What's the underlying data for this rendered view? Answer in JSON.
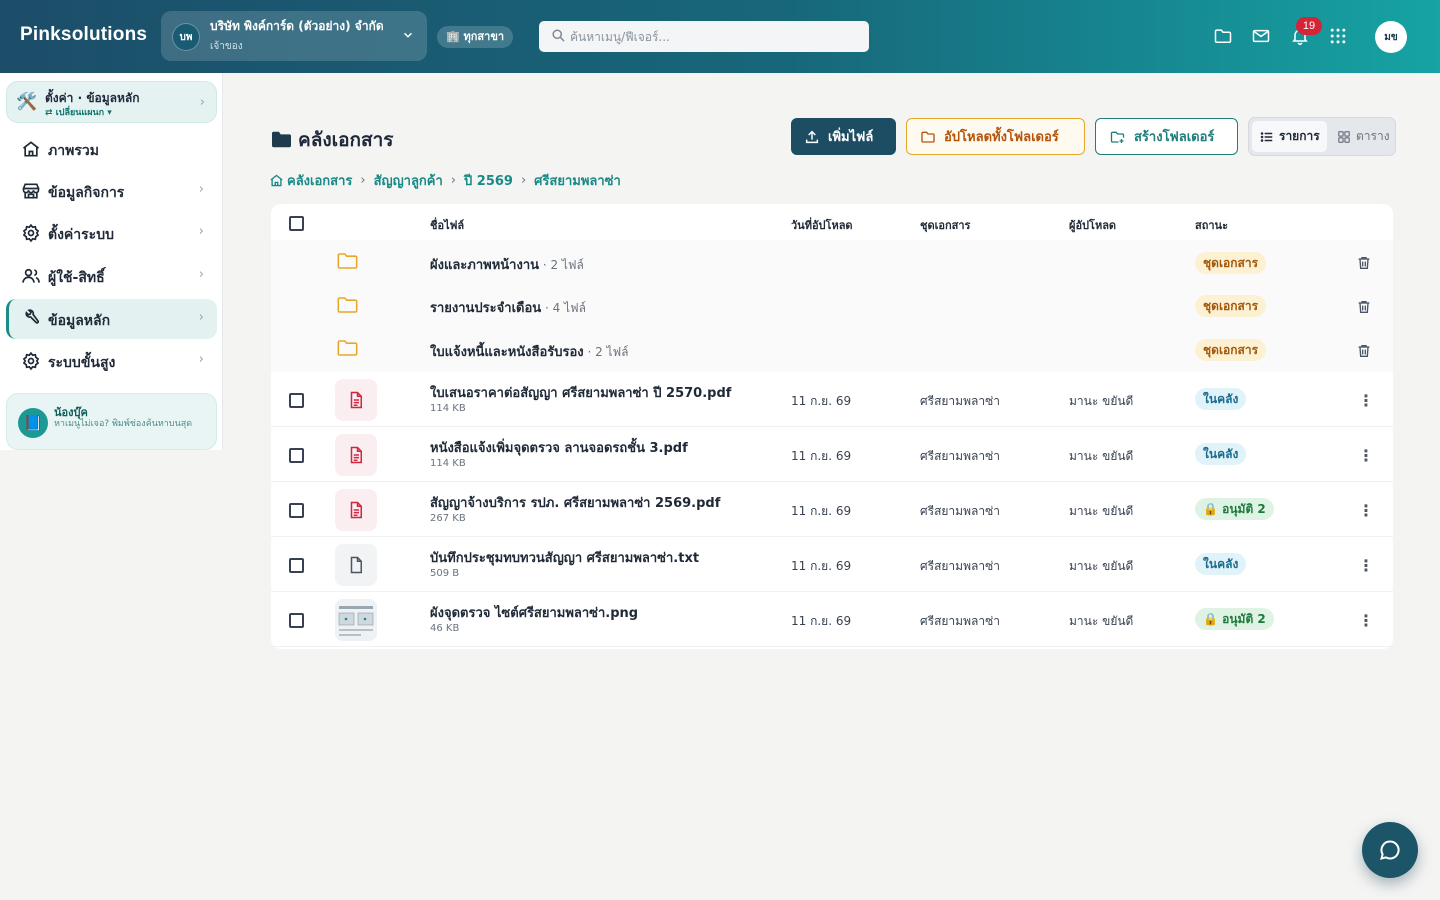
{
  "header": {
    "brand": "Pinksolutions",
    "company": {
      "initials": "บพ",
      "name": "บริษัท พิงค์การ์ด (ตัวอย่าง) จำกัด",
      "role": "เจ้าของ"
    },
    "branch_label": "🏢 ทุกสาขา",
    "search_placeholder": "ค้นหาเมนู/ฟีเจอร์...",
    "notification_count": "19",
    "user_initials": "มข"
  },
  "sidebar": {
    "top": {
      "title": "ตั้งค่า · ข้อมูลหลัก",
      "subtitle": "⇄ เปลี่ยนแผนก ▾"
    },
    "items": [
      {
        "label": "ภาพรวม",
        "icon": "home-icon",
        "active": false
      },
      {
        "label": "ข้อมูลกิจการ",
        "icon": "store-icon",
        "active": false
      },
      {
        "label": "ตั้งค่าระบบ",
        "icon": "gear-icon",
        "active": false
      },
      {
        "label": "ผู้ใช้-สิทธิ์",
        "icon": "users-icon",
        "active": false
      },
      {
        "label": "ข้อมูลหลัก",
        "icon": "wrench-icon",
        "active": true
      },
      {
        "label": "ระบบขั้นสูง",
        "icon": "advanced-gear-icon",
        "active": false
      }
    ],
    "helper": {
      "name": "น้องบุ๊ค",
      "text": "หาเมนูไม่เจอ? พิมพ์ช่องค้นหาบนสุด"
    }
  },
  "main": {
    "title": "คลังเอกสาร",
    "buttons": {
      "add": "เพิ่มไฟล์",
      "upload_folder": "อัปโหลดทั้งโฟลเดอร์",
      "create_folder": "สร้างโฟลเดอร์"
    },
    "view": {
      "list": "รายการ",
      "grid": "ตาราง"
    },
    "breadcrumb": [
      "คลังเอกสาร",
      "สัญญาลูกค้า",
      "ปี 2569",
      "ศรีสยามพลาซ่า"
    ],
    "columns": {
      "name": "ชื่อไฟล์",
      "date": "วันที่อัปโหลด",
      "set": "ชุดเอกสาร",
      "uploader": "ผู้อัปโหลด",
      "status": "สถานะ"
    },
    "folders": [
      {
        "name": "ผังและภาพหน้างาน",
        "count": " · 2 ไฟล์",
        "status": "ชุดเอกสาร"
      },
      {
        "name": "รายงานประจำเดือน",
        "count": " · 4 ไฟล์",
        "status": "ชุดเอกสาร"
      },
      {
        "name": "ใบแจ้งหนี้และหนังสือรับรอง",
        "count": " · 2 ไฟล์",
        "status": "ชุดเอกสาร"
      }
    ],
    "files": [
      {
        "name": "ใบเสนอราคาต่อสัญญา ศรีสยามพลาซ่า ปี 2570.pdf",
        "size": "114 KB",
        "date": "11 ก.ย. 69",
        "set": "ศรีสยามพลาซ่า",
        "uploader": "มานะ ขยันดี",
        "status": "ในคลัง",
        "status_kind": "in",
        "type": "pdf"
      },
      {
        "name": "หนังสือแจ้งเพิ่มจุดตรวจ ลานจอดรถชั้น 3.pdf",
        "size": "114 KB",
        "date": "11 ก.ย. 69",
        "set": "ศรีสยามพลาซ่า",
        "uploader": "มานะ ขยันดี",
        "status": "ในคลัง",
        "status_kind": "in",
        "type": "pdf"
      },
      {
        "name": "สัญญาจ้างบริการ รปภ. ศรีสยามพลาซ่า 2569.pdf",
        "size": "267 KB",
        "date": "11 ก.ย. 69",
        "set": "ศรีสยามพลาซ่า",
        "uploader": "มานะ ขยันดี",
        "status": "🔒 อนุมัติ 2",
        "status_kind": "ok",
        "type": "pdf"
      },
      {
        "name": "บันทึกประชุมทบทวนสัญญา ศรีสยามพลาซ่า.txt",
        "size": "509 B",
        "date": "11 ก.ย. 69",
        "set": "ศรีสยามพลาซ่า",
        "uploader": "มานะ ขยันดี",
        "status": "ในคลัง",
        "status_kind": "in",
        "type": "txt"
      },
      {
        "name": "ผังจุดตรวจ ไซต์ศรีสยามพลาซ่า.png",
        "size": "46 KB",
        "date": "11 ก.ย. 69",
        "set": "ศรีสยามพลาซ่า",
        "uploader": "มานะ ขยันดี",
        "status": "🔒 อนุมัติ 2",
        "status_kind": "ok",
        "type": "png"
      }
    ]
  }
}
